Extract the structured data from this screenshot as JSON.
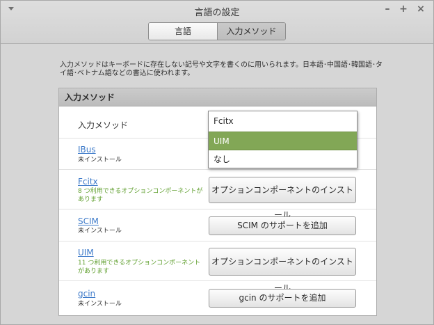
{
  "window": {
    "title": "言語の設定"
  },
  "tabs": [
    {
      "label": "言語"
    },
    {
      "label": "入力メソッド"
    }
  ],
  "description": "入力メソッドはキーボードに存在しない記号や文字を書くのに用いられます。日本語･中国語･韓国語･タイ語･ベトナム語などの書込に使われます。",
  "panel": {
    "header": "入力メソッド",
    "selector_label": "入力メソッド",
    "dropdown": {
      "options": [
        "Fcitx",
        "UIM",
        "なし"
      ],
      "selected": "UIM"
    },
    "rows": [
      {
        "name": "IBus",
        "status": "未インストール",
        "button": ""
      },
      {
        "name": "Fcitx",
        "status": "8 つ利用できるオプションコンポーネントがあります",
        "button": "オプションコンポーネントのインストール"
      },
      {
        "name": "SCIM",
        "status": "未インストール",
        "button": "SCIM のサポートを追加"
      },
      {
        "name": "UIM",
        "status": "11 つ利用できるオプションコンポーネントがあります",
        "button": "オプションコンポーネントのインストール"
      },
      {
        "name": "gcin",
        "status": "未インストール",
        "button": "gcin のサポートを追加"
      }
    ]
  },
  "colors": {
    "selection": "#82a756",
    "link": "#3d7ac9",
    "status_available": "#5e9e2c"
  }
}
